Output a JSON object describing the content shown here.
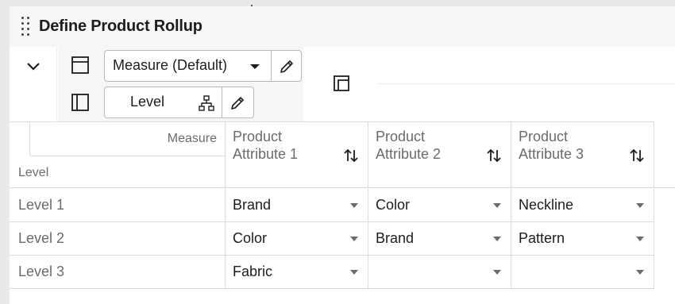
{
  "title": "Define Product Rollup",
  "toolbar": {
    "collapse_icon": "chevron-down-icon",
    "row_layout_icon": "row-layout-icon",
    "column_layout_icon": "column-layout-icon",
    "measure_select": {
      "value": "Measure (Default)",
      "edit_icon": "pencil-icon"
    },
    "level_select": {
      "value": "Level",
      "hierarchy_icon": "hierarchy-icon",
      "edit_icon": "pencil-icon"
    },
    "freeze_icon": "freeze-panes-icon"
  },
  "grid": {
    "corner": {
      "measure_label": "Measure",
      "level_label": "Level"
    },
    "columns": [
      {
        "line1": "Product",
        "line2": "Attribute 1",
        "sort_icon": "sort-icon"
      },
      {
        "line1": "Product",
        "line2": "Attribute 2",
        "sort_icon": "sort-icon"
      },
      {
        "line1": "Product",
        "line2": "Attribute 3",
        "sort_icon": "sort-icon"
      }
    ],
    "rows": [
      {
        "label": "Level 1",
        "cells": [
          "Brand",
          "Color",
          "Neckline"
        ]
      },
      {
        "label": "Level 2",
        "cells": [
          "Color",
          "Brand",
          "Pattern"
        ]
      },
      {
        "label": "Level 3",
        "cells": [
          "Fabric",
          "",
          ""
        ]
      }
    ]
  },
  "colors": {
    "panel_bg": "#f6f6f6",
    "border": "#dcdcdc",
    "muted_text": "#6b6b6b"
  }
}
